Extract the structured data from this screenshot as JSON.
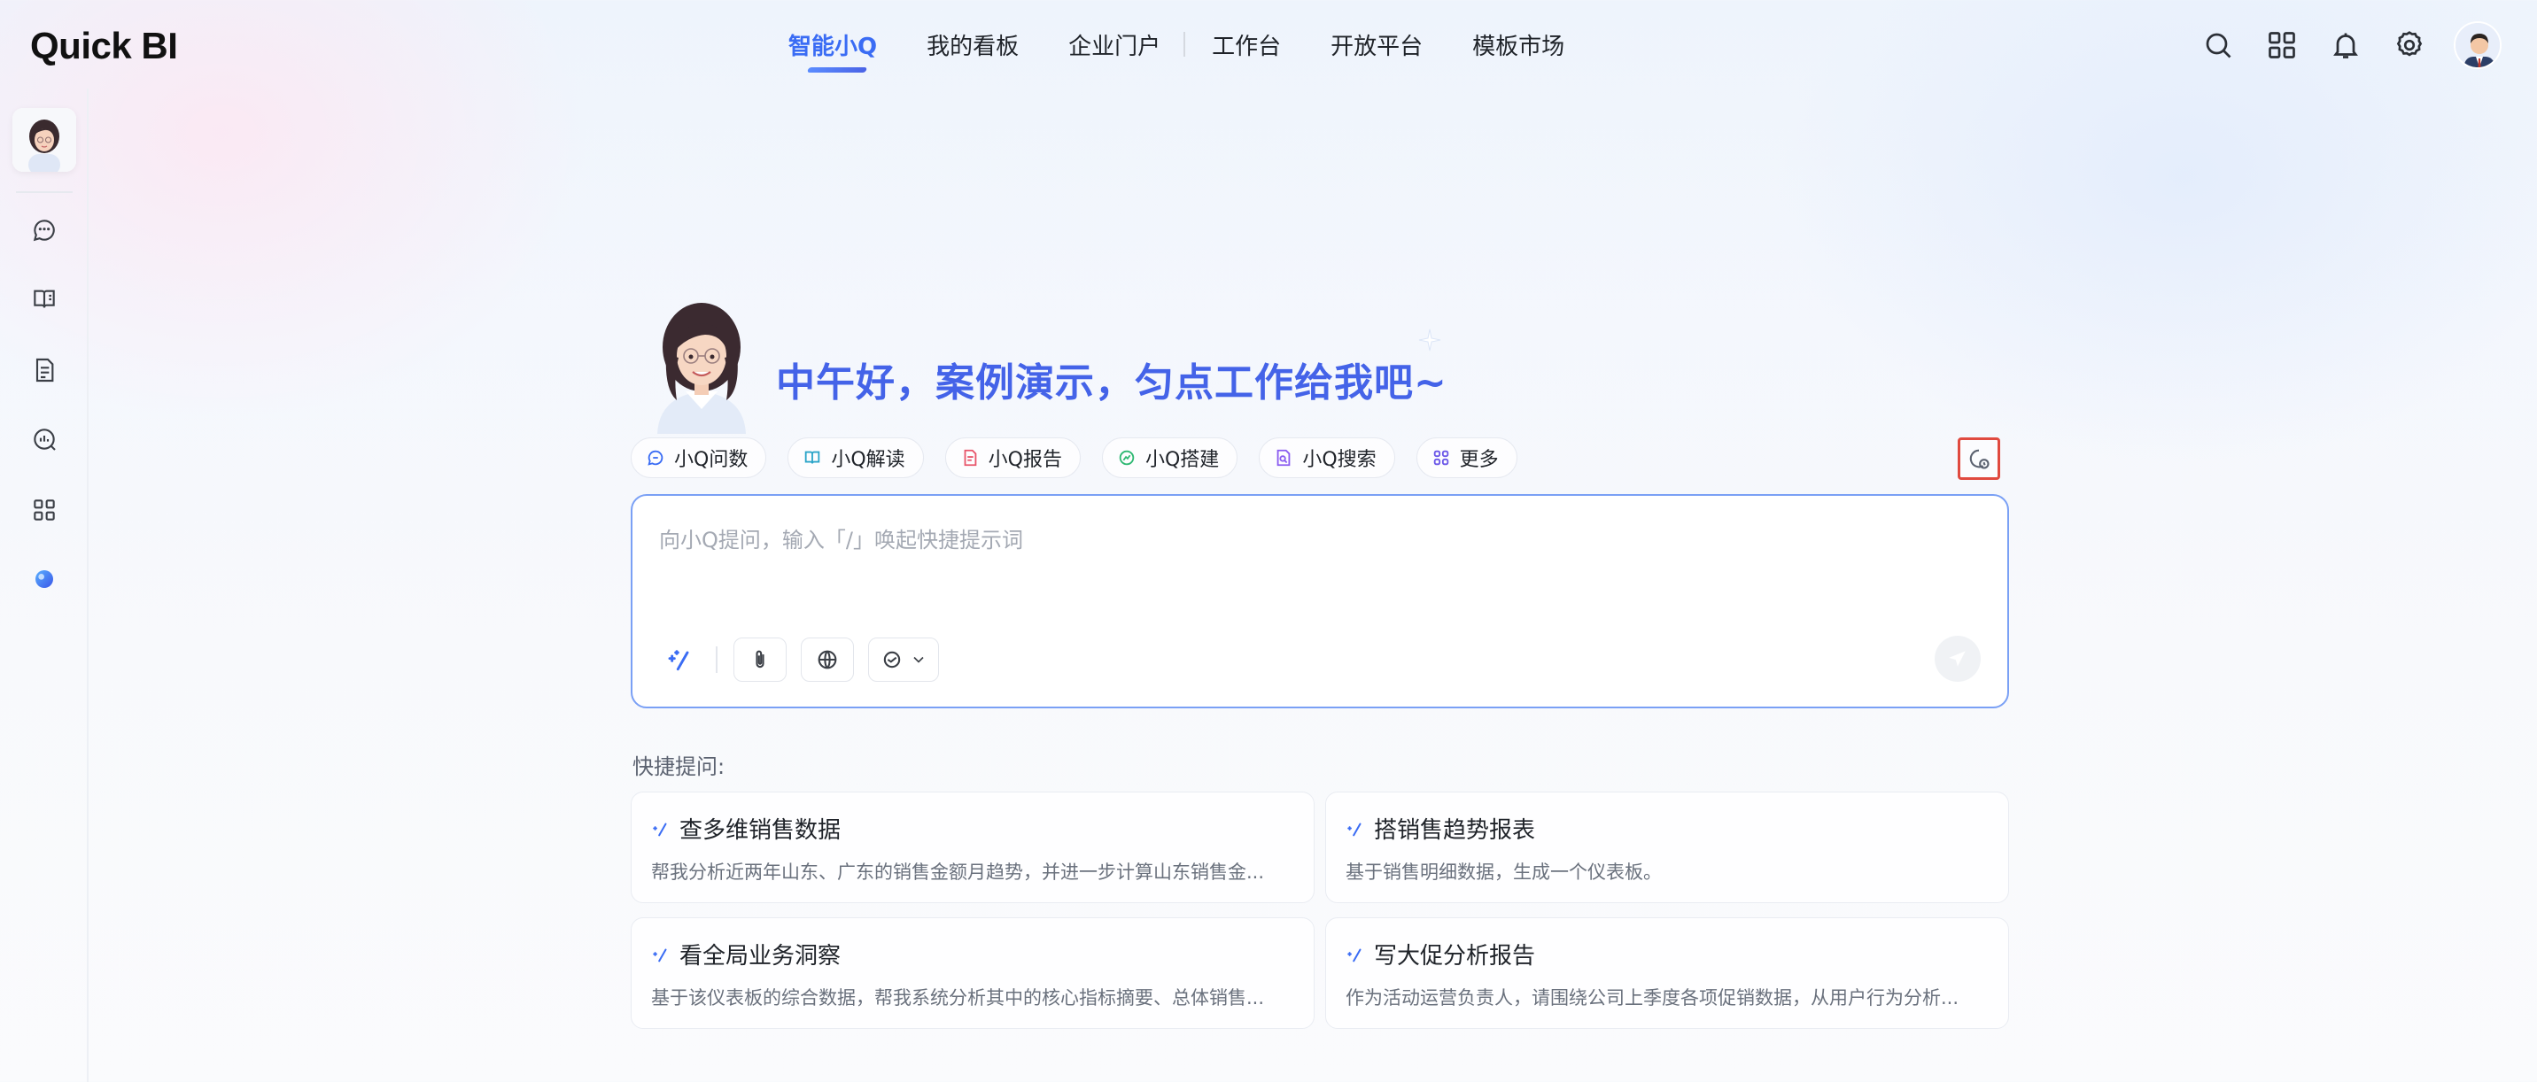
{
  "app": {
    "logo": "Quick BI"
  },
  "nav": {
    "items": [
      {
        "label": "智能小Q",
        "active": true
      },
      {
        "label": "我的看板"
      },
      {
        "label": "企业门户"
      },
      {
        "label": "工作台"
      },
      {
        "label": "开放平台"
      },
      {
        "label": "模板市场"
      }
    ]
  },
  "header_icons": [
    "search-icon",
    "grid-apps-icon",
    "bell-icon",
    "gear-icon",
    "user-avatar"
  ],
  "sidebar": {
    "icons": [
      "chat-question-icon",
      "book-interpret-icon",
      "report-doc-icon",
      "analysis-search-icon",
      "apps-grid-icon",
      "orb-toggle-icon"
    ]
  },
  "hero": {
    "greeting": "中午好，案例演示，匀点工作给我吧~"
  },
  "chips": [
    {
      "label": "小Q问数",
      "icon": "chat-data-icon",
      "color": "#3a6cf4"
    },
    {
      "label": "小Q解读",
      "icon": "book-icon",
      "color": "#2aa4c8"
    },
    {
      "label": "小Q报告",
      "icon": "report-icon",
      "color": "#e8556a"
    },
    {
      "label": "小Q搭建",
      "icon": "build-icon",
      "color": "#2eb872"
    },
    {
      "label": "小Q搜索",
      "icon": "doc-search-icon",
      "color": "#8a5cf0"
    },
    {
      "label": "更多",
      "icon": "more-grid-icon",
      "color": "#6b57e8"
    }
  ],
  "input": {
    "placeholder": "向小Q提问，输入「/」唤起快捷提示词"
  },
  "quick": {
    "label": "快捷提问:",
    "cards": [
      {
        "title": "查多维销售数据",
        "desc": "帮我分析近两年山东、广东的销售金额月趋势，并进一步计算山东销售金..."
      },
      {
        "title": "搭销售趋势报表",
        "desc": "基于销售明细数据，生成一个仪表板。"
      },
      {
        "title": "看全局业务洞察",
        "desc": "基于该仪表板的综合数据，帮我系统分析其中的核心指标摘要、总体销售..."
      },
      {
        "title": "写大促分析报告",
        "desc": "作为活动运营负责人，请围绕公司上季度各项促销数据，从用户行为分析..."
      }
    ]
  },
  "colors": {
    "accent": "#3a6cf4",
    "history_highlight": "#e04a3f"
  }
}
